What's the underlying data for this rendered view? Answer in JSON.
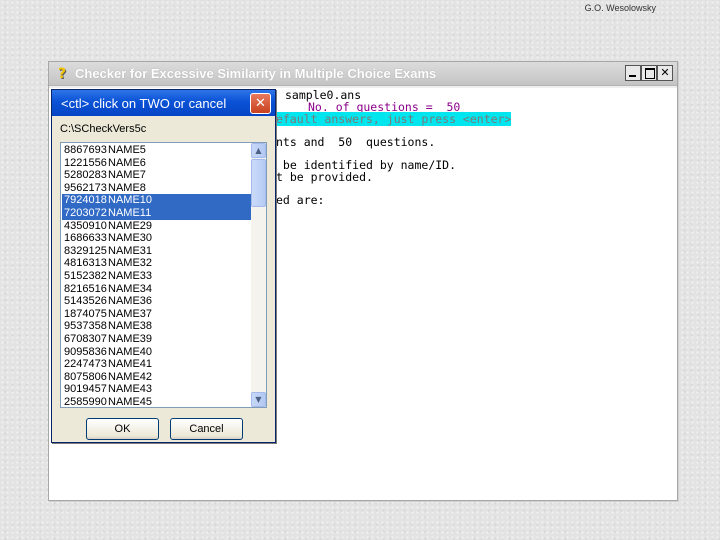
{
  "author_credit": "G.O. Wesolowsky",
  "main_window": {
    "title": "Checker for Excessive Similarity in Multiple Choice Exams",
    "help_icon_glyph": "?",
    "help_icon": "help-question-icon",
    "minimize_glyph": "",
    "maximize_glyph": "",
    "close_glyph": "✕"
  },
  "console": {
    "line1": "sample0.ans",
    "line2": "No. of questions =  50",
    "line3": "efault answers, just press <enter>",
    "line4": "nts and  50  questions.",
    "line5": " be identified by name/ID.",
    "line6": "t be provided.",
    "line7": "ed are:"
  },
  "dialog": {
    "title": "<ctl> click on TWO or cancel",
    "close_glyph": "✕",
    "path": "C:\\SCheckVers5c",
    "items": [
      {
        "id": "8867693",
        "name": "NAME5"
      },
      {
        "id": "1221556",
        "name": "NAME6"
      },
      {
        "id": "5280283",
        "name": "NAME7"
      },
      {
        "id": "9562173",
        "name": "NAME8"
      },
      {
        "id": "7924018",
        "name": "NAME10"
      },
      {
        "id": "7203072",
        "name": "NAME11"
      },
      {
        "id": "4350910",
        "name": "NAME29"
      },
      {
        "id": "1686633",
        "name": "NAME30"
      },
      {
        "id": "8329125",
        "name": "NAME31"
      },
      {
        "id": "4816313",
        "name": "NAME32"
      },
      {
        "id": "5152382",
        "name": "NAME33"
      },
      {
        "id": "8216516",
        "name": "NAME34"
      },
      {
        "id": "5143526",
        "name": "NAME36"
      },
      {
        "id": "1874075",
        "name": "NAME37"
      },
      {
        "id": "9537358",
        "name": "NAME38"
      },
      {
        "id": "6708307",
        "name": "NAME39"
      },
      {
        "id": "9095836",
        "name": "NAME40"
      },
      {
        "id": "2247473",
        "name": "NAME41"
      },
      {
        "id": "8075806",
        "name": "NAME42"
      },
      {
        "id": "9019457",
        "name": "NAME43"
      },
      {
        "id": "2585990",
        "name": "NAME45"
      }
    ],
    "selected_indices": [
      4,
      5
    ],
    "scroll_up_glyph": "▲",
    "scroll_down_glyph": "▼",
    "ok_label": "OK",
    "cancel_label": "Cancel"
  },
  "colors": {
    "console_purple": "#8b008b",
    "highlight_cyan": "#00e5ee",
    "selection_blue": "#316ac5",
    "dialog_title_blue": "#0a52d6",
    "dialog_close_red": "#c8411f"
  }
}
